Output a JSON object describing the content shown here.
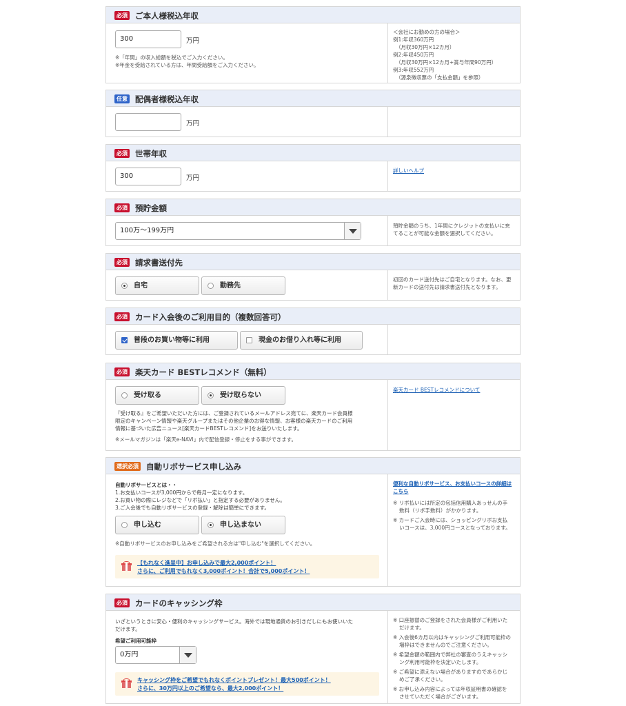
{
  "badges": {
    "required": "必須",
    "optional": "任意",
    "select_required": "選択必須"
  },
  "unit_man_yen": "万円",
  "income": {
    "title": "ご本人様税込年収",
    "value": "300",
    "notes": [
      "※「年間」の収入総額を税込でご入力ください。",
      "※年金を受給されている方は、年間受給額をご入力ください。"
    ],
    "side": [
      "＜会社にお勤めの方の場合＞",
      "例1:年収360万円",
      "（月収30万円×12カ月）",
      "例2:年収450万円",
      "（月収30万円×12カ月+賞与年間90万円）",
      "例3:年収552万円",
      "（源泉徴収票の「支払金額」を参照）"
    ]
  },
  "spouse_income": {
    "title": "配偶者様税込年収",
    "value": ""
  },
  "household_income": {
    "title": "世帯年収",
    "value": "300",
    "help_link": "詳しいヘルプ"
  },
  "savings": {
    "title": "預貯金額",
    "selected": "100万〜199万円",
    "side": [
      "預貯金額のうち、1年間にクレジットの支払いに充",
      "てることが可能な金額を選択してください。"
    ]
  },
  "billing_address": {
    "title": "請求書送付先",
    "options": [
      "自宅",
      "勤務先"
    ],
    "side": [
      "初回のカード送付先はご自宅となります。なお、更",
      "新カードの送付先は請求書送付先となります。"
    ]
  },
  "purpose": {
    "title": "カード入会後のご利用目的（複数回答可）",
    "options": [
      "普段のお買い物等に利用",
      "現金のお借り入れ等に利用"
    ]
  },
  "best_recommend": {
    "title": "楽天カード BESTレコメンド（無料）",
    "options": [
      "受け取る",
      "受け取らない"
    ],
    "desc": [
      "『受け取る』をご希望いただいた方には、ご登録されているメールアドレス宛てに、楽天カード会員様",
      "限定のキャンペーン情報や楽天グループまたはその他企業のお得な情報、お客様の楽天カードのご利用",
      "情報に基づいた広告ニュース[楽天カードBESTレコメンド]をお送りいたします。"
    ],
    "note": "※メールマガジンは「楽天e-NAVI」内で配信登録・停止をする事ができます。",
    "side_link": "楽天カード BESTレコメンドについて"
  },
  "auto_revo": {
    "title": "自動リボサービス申し込み",
    "subhead": "自動リボサービスとは・・",
    "lines": [
      "1.お支払いコースが3,000円からで毎月一定になります。",
      "2.お買い物の際にレジなどで「リボ払い」と指定する必要がありません。",
      "3.ご入会後でも自動リボサービスの登録・解除は簡単にできます。"
    ],
    "options": [
      "申し込む",
      "申し込まない"
    ],
    "note": "※自動リボサービスのお申し込みをご希望される方は\"申し込む\"を選択してください。",
    "promo": [
      "【もれなく進呈中】お申し込みで最大2,000ポイント！",
      "さらに、ご利用でもれなく3,000ポイント！合計で5,000ポイント！"
    ],
    "side_link": [
      "便利な自動リボサービス、お支払いコースの詳細は",
      "こちら"
    ],
    "side_notes": [
      "※ リボ払いには所定の包括信用購入あっせんの手",
      "数料（リボ手数料）がかかります。",
      "※ カードご入会時には、ショッピングリボお支払",
      "いコースは、3,000円コースとなっております。"
    ]
  },
  "cashing": {
    "title": "カードのキャッシング枠",
    "desc": [
      "いざというときに安心・便利のキャッシングサービス。海外では現地通貨のお引きだしにもお使いいた",
      "だけます。"
    ],
    "subhead": "希望ご利用可能枠",
    "selected": "0万円",
    "promo": [
      "キャッシング枠をご希望でもれなくポイントプレゼント！最大500ポイント！",
      "さらに、30万円以上のご希望なら、最大2,000ポイント！"
    ],
    "side_notes": [
      "※ 口座振替のご登録をされた会員様がご利用いた",
      "だけます。",
      "※ 入会後6カ月以内はキャッシングご利用可能枠の",
      "増枠はできませんのでご注意ください。",
      "※ 希望金額の範囲内で弊社の審査のうえキャッシ",
      "ング利用可能枠を決定いたします。",
      "※ ご希望に添えない場合がありますのであらかじ",
      "めご了承ください。",
      "※ お申し込み内容によっては年収証明書の確認を",
      "させていただく場合がございます。"
    ]
  }
}
